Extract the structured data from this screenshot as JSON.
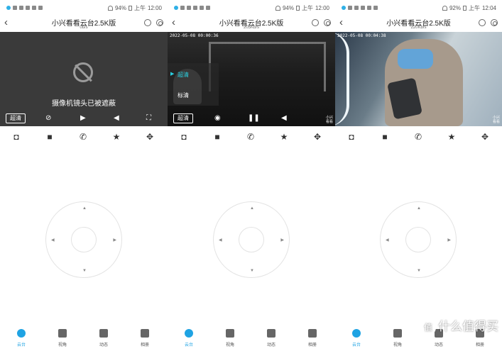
{
  "panels": [
    {
      "status": {
        "time": "12:00",
        "battery": "94%",
        "ampm": "上午"
      },
      "title": "小兴看看云台2.5K版",
      "rate": "0b/s",
      "video": {
        "cover_message": "摄像机镜头已被遮蔽",
        "quality": "超清"
      },
      "nav": [
        "云台",
        "视角",
        "动态",
        "相册"
      ]
    },
    {
      "status": {
        "time": "12:00",
        "battery": "94%",
        "ampm": "上午"
      },
      "title": "小兴看看云台2.5K版",
      "rate": "205Kb/s",
      "video": {
        "timestamp": "2022-05-08 00:00:36",
        "quality": "超清",
        "quality_options": [
          "超清",
          "标清"
        ],
        "zoom_label_1": "小兴",
        "zoom_label_2": "看看"
      },
      "nav": [
        "云台",
        "视角",
        "动态",
        "相册"
      ]
    },
    {
      "status": {
        "time": "12:04",
        "battery": "92%",
        "ampm": "上午"
      },
      "title": "小兴看看云台2.5K版",
      "rate": "220Kb/s",
      "video": {
        "timestamp": "2022-05-08 00:04:38",
        "zoom_label_1": "小兴",
        "zoom_label_2": "看看"
      },
      "nav": [
        "云台",
        "视角",
        "动态",
        "相册"
      ]
    }
  ],
  "watermark": {
    "text": "什么值得买",
    "badge": "值"
  },
  "colors": {
    "accent": "#1fa3e3",
    "quality_active": "#2ad0e0"
  },
  "icons": {
    "toolbar": [
      "camera-icon",
      "video-record-icon",
      "phone-icon",
      "star-icon",
      "ptz-move-icon"
    ],
    "nav": [
      "ptz-icon",
      "view-angle-icon",
      "motion-icon",
      "album-icon"
    ]
  }
}
